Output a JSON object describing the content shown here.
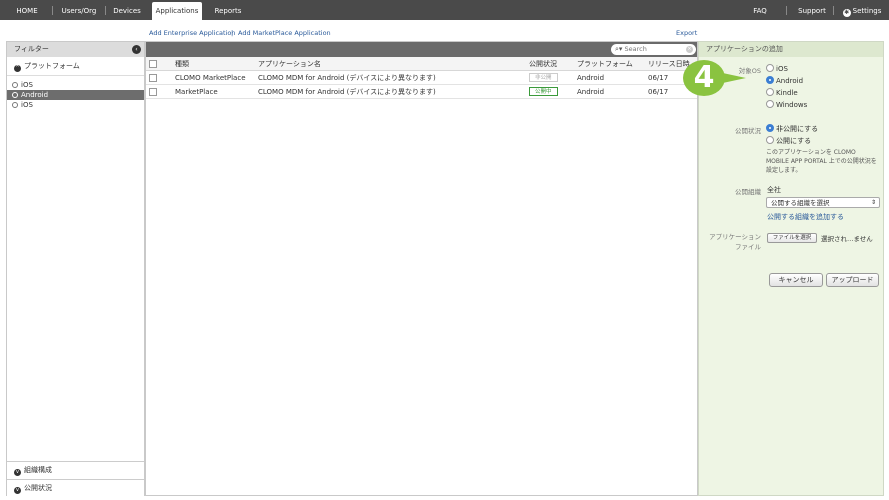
{
  "nav": {
    "home": "HOME",
    "users_org": "Users/Org",
    "devices": "Devices",
    "applications": "Applications",
    "reports": "Reports",
    "faq": "FAQ",
    "support": "Support",
    "settings": "Settings"
  },
  "sublinks": {
    "add_enterprise": "Add Enterprise Application",
    "separator": "|",
    "add_marketplace": "Add MarketPlace Application",
    "export": "Export"
  },
  "filter": {
    "title": "フィルター",
    "platform_section": "プラットフォーム",
    "platforms": [
      {
        "label": "iOS",
        "selected": false
      },
      {
        "label": "Android",
        "selected": true
      },
      {
        "label": "iOS",
        "selected": false
      }
    ],
    "org_section": "組織構成",
    "status_section": "公開状況"
  },
  "search": {
    "placeholder": "Search"
  },
  "table": {
    "headers": {
      "type": "種類",
      "name": "アプリケーション名",
      "status": "公開状況",
      "platform": "プラットフォーム",
      "release": "リリース日時"
    },
    "rows": [
      {
        "type": "CLOMO MarketPlace",
        "name": "CLOMO MDM for Android (デバイスにより異なります)",
        "status": "非公開",
        "status_public": false,
        "platform": "Android",
        "release": "06/17"
      },
      {
        "type": "MarketPlace",
        "name": "CLOMO MDM for Android (デバイスにより異なります)",
        "status": "公開中",
        "status_public": true,
        "platform": "Android",
        "release": "06/17"
      }
    ]
  },
  "add_panel": {
    "title": "アプリケーションの追加",
    "target_os_label": "対象OS",
    "os_options": [
      {
        "label": "iOS",
        "selected": false
      },
      {
        "label": "Android",
        "selected": true
      },
      {
        "label": "Kindle",
        "selected": false
      },
      {
        "label": "Windows",
        "selected": false
      }
    ],
    "publish_label": "公開状況",
    "publish_options": [
      {
        "label": "非公開にする",
        "selected": true
      },
      {
        "label": "公開にする",
        "selected": false
      }
    ],
    "publish_note": "このアプリケーションを CLOMO MOBILE APP PORTAL 上での公開状況を設定します。",
    "org_label": "公開組織",
    "org_value": "全社",
    "org_select": "公開する組織を選択",
    "org_add_link": "公開する組織を追加する",
    "file_label_line1": "アプリケーション",
    "file_label_line2": "ファイル",
    "file_button": "ファイルを選択",
    "file_status": "選択され…ません",
    "cancel": "キャンセル",
    "upload": "アップロード"
  },
  "step_marker": "4",
  "colors": {
    "nav_bg": "#4a4a4a",
    "panel_green": "#eef5e4",
    "marker_green": "#8ac340",
    "link_blue": "#2a5a9a",
    "public_green": "#3a9a3a"
  }
}
